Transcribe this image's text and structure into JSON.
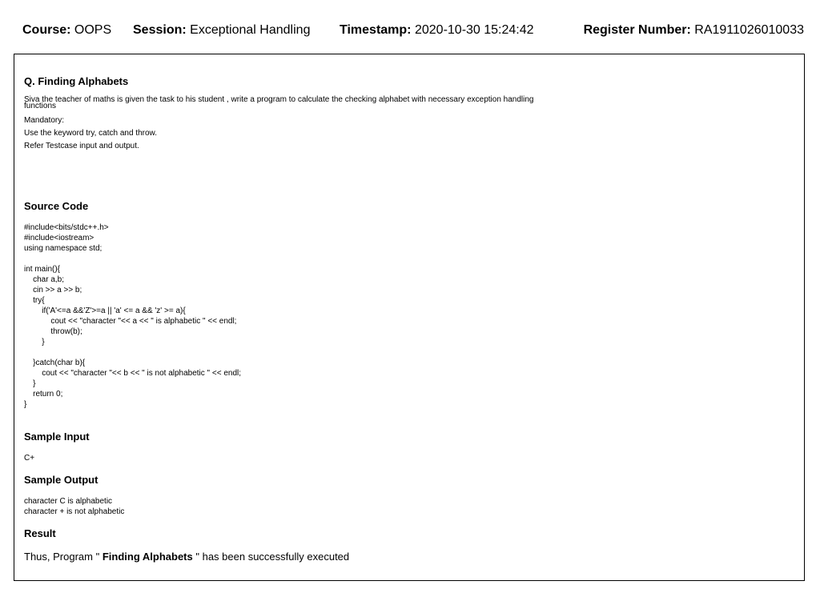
{
  "header": {
    "course_label": "Course:",
    "course_value": "OOPS",
    "session_label": "Session:",
    "session_value": "Exceptional Handling",
    "timestamp_label": "Timestamp:",
    "timestamp_value": "2020-10-30 15:24:42",
    "register_label": "Register Number:",
    "register_value": "RA1911026010033"
  },
  "question": {
    "title": "Q. Finding Alphabets",
    "description": "Siva the teacher of maths is given the task to his student , write a program to calculate the checking alphabet with necessary exception handling functions",
    "mandatory": "Mandatory:",
    "instruction1": "Use the keyword try, catch and throw.",
    "instruction2": "Refer Testcase input and output."
  },
  "source": {
    "heading": "Source Code",
    "code": "#include<bits/stdc++.h>\n#include<iostream>\nusing namespace std;\n\nint main(){\n    char a,b;\n    cin >> a >> b;\n    try{\n        if('A'<=a &&'Z'>=a || 'a' <= a && 'z' >= a){\n            cout << \"character \"<< a << \" is alphabetic \" << endl;\n            throw(b);\n        }\n\n    }catch(char b){\n        cout << \"character \"<< b << \" is not alphabetic \" << endl;\n    }\n    return 0;\n}"
  },
  "sample_input": {
    "heading": "Sample Input",
    "text": "C+"
  },
  "sample_output": {
    "heading": "Sample Output",
    "line1": "character C is alphabetic",
    "line2": "character + is not alphabetic"
  },
  "result": {
    "heading": "Result",
    "prefix": "Thus, Program \"",
    "program_name": "Finding Alphabets",
    "suffix": "\" has been successfully executed"
  }
}
